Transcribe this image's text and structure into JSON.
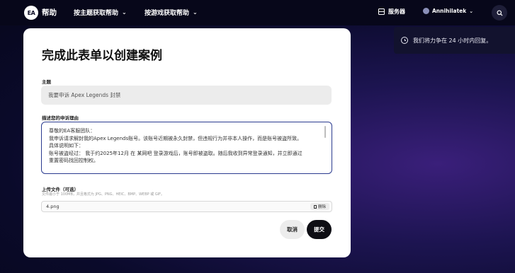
{
  "header": {
    "logo_text": "EA",
    "help_title": "帮助",
    "nav": [
      {
        "label": "按主题获取帮助"
      },
      {
        "label": "按游戏获取帮助"
      }
    ],
    "servers_label": "服务器",
    "username": "Annihilatek"
  },
  "notice": {
    "text": "我们将力争在 24 小时内回复。"
  },
  "form": {
    "title": "完成此表单以创建案例",
    "subject_label": "主题",
    "subject_value": "我要申诉 Apex Legends 封禁",
    "description_label": "描述您的申诉理由",
    "description_lines": [
      "尊敬的EA客服团队：",
      "我申诉请求解封我的Apex Legends账号。该账号近期被永久封禁，但违规行为并非本人操作，而是账号被盗所致。",
      "具体说明如下：",
      "账号被盗经过： 我于约2025年12月 在 某网吧 登录游戏后，账号即被盗取。随后我收到异常登录通知，并立即通过",
      "重置密码找回控制权。"
    ],
    "upload_label": "上传文件（可选）",
    "upload_hint": "文件最小于 100MB，并且格式为 JPG、PNG、HEIC、BMP、WEBP 或 GIF。",
    "file_name": "4.png",
    "delete_label": "删除",
    "cancel_label": "取消",
    "submit_label": "提交"
  }
}
